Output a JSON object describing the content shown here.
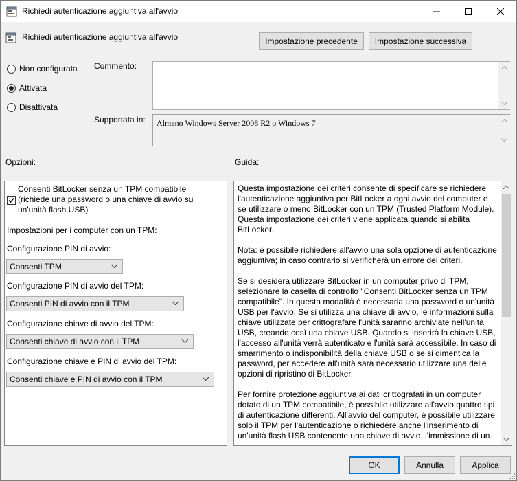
{
  "window": {
    "title": "Richiedi autenticazione aggiuntiva all'avvio"
  },
  "header": {
    "setting_name": "Richiedi autenticazione aggiuntiva all'avvio",
    "prev_button": "Impostazione precedente",
    "next_button": "Impostazione successiva"
  },
  "state": {
    "options": [
      {
        "label": "Non configurata",
        "checked": false
      },
      {
        "label": "Attivata",
        "checked": true
      },
      {
        "label": "Disattivata",
        "checked": false
      }
    ]
  },
  "comment": {
    "label": "Commento:",
    "value": ""
  },
  "supported": {
    "label": "Supportata in:",
    "value": "Almeno Windows Server 2008 R2 o Windows 7"
  },
  "options_panel": {
    "title": "Opzioni:",
    "checkbox_label_1": "Consenti BitLocker senza un TPM compatibile",
    "checkbox_label_2": "(richiede una password o una chiave di avvio su",
    "checkbox_label_3": "un'unità flash USB)",
    "checkbox_checked": true,
    "section_label": "Impostazioni per i computer con un TPM:",
    "dropdowns": [
      {
        "label": "Configurazione PIN di avvio:",
        "value": "Consenti TPM"
      },
      {
        "label": "Configurazione PIN di avvio del TPM:",
        "value": "Consenti PIN di avvio con il TPM"
      },
      {
        "label": "Configurazione chiave di avvio del TPM:",
        "value": "Consenti chiave di avvio con il TPM"
      },
      {
        "label": "Configurazione chiave e PIN di avvio del TPM:",
        "value": "Consenti chiave e PIN di avvio con il TPM"
      }
    ]
  },
  "help_panel": {
    "title": "Guida:",
    "paragraphs": [
      "Questa impostazione dei criteri consente di specificare se richiedere l'autenticazione aggiuntiva per BitLocker a ogni avvio del computer e se utilizzare o meno BitLocker con un TPM (Trusted Platform Module). Questa impostazione dei criteri viene applicata quando si abilita BitLocker.",
      "Nota: è possibile richiedere all'avvio una sola opzione di autenticazione aggiuntiva; in caso contrario si verificherà un errore dei criteri.",
      "Se si desidera utilizzare BitLocker in un computer privo di TPM, selezionare la casella di controllo \"Consenti BitLocker senza un TPM compatibile\". In questa modalità è necessaria una password o un'unità USB per l'avvio. Se si utilizza una chiave di avvio, le informazioni sulla chiave utilizzate per crittografare l'unità saranno archiviate nell'unità USB, creando così una chiave USB. Quando si inserirà la chiave USB, l'accesso all'unità verrà autenticato e l'unità sarà accessibile. In caso di smarrimento o indisponibilità della chiave USB o se si dimentica la password, per accedere all'unità sarà necessario utilizzare una delle opzioni di ripristino di BitLocker.",
      "Per fornire protezione aggiuntiva ai dati crittografati in un computer dotato di un TPM compatibile, è possibile utilizzare all'avvio quattro tipi di autenticazione differenti. All'avvio del computer, è possibile utilizzare solo il TPM per l'autenticazione o richiedere anche l'inserimento di un'unità flash USB contenente una chiave di avvio, l'immissione di un"
    ]
  },
  "footer": {
    "ok": "OK",
    "cancel": "Annulla",
    "apply": "Applica"
  },
  "colors": {
    "accent": "#0078d7",
    "window_bg": "#f0f0f0",
    "button_bg": "#e1e1e1"
  }
}
